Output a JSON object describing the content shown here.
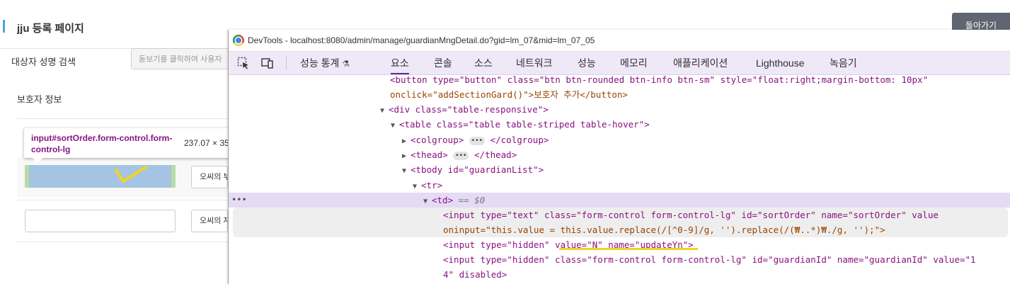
{
  "page": {
    "title": "jju 등록 페이지",
    "back_button": "돌아가기",
    "search_label": "대상자 성명 검색",
    "search_placeholder": "돋보기를 클릭하여 사용자",
    "guardian_section": "보호자 정보",
    "row1_button": "오씨의 부",
    "row2_button": "오씨의 자"
  },
  "inspector_tooltip": {
    "selector": "input#sortOrder.form-control.form-control-lg",
    "size": "237.07 × 35"
  },
  "devtools": {
    "title": "DevTools - localhost:8080/admin/manage/guardianMngDetail.do?gid=lm_07&mid=lm_07_05",
    "tabs": [
      "성능 통계",
      "요소",
      "콘솔",
      "소스",
      "네트워크",
      "성능",
      "메모리",
      "애플리케이션",
      "Lighthouse",
      "녹음기"
    ],
    "active_tab": "요소",
    "lines": {
      "l0a": "<button type=\"button\" class=\"btn btn-rounded btn-info btn-sm\" style=\"float:right;margin-bottom: 10px\"",
      "l0b": "onclick=\"addSectionGard()\">보호자 추가</button>",
      "l1": "<div class=\"table-responsive\">",
      "l2": "<table class=\"table table-striped table-hover\">",
      "l3a": "<colgroup>",
      "l3b": "</colgroup>",
      "l4a": "<thead>",
      "l4b": "</thead>",
      "l5": "<tbody id=\"guardianList\">",
      "l6": "<tr>",
      "l7a": "<td>",
      "l7b": "== $0",
      "l8a": "<input type=\"text\" class=\"form-control form-control-lg\" id=\"sortOrder\" name=\"sortOrder\" value",
      "l8b": "oninput=\"this.value = this.value.replace(/[^0-9]/g, '').replace(/(₩..*)₩./g, '');\">",
      "l9": "<input type=\"hidden\" value=\"N\" name=\"updateYn\">",
      "l10a": "<input type=\"hidden\" class=\"form-control form-control-lg\" id=\"guardianId\" name=\"guardianId\" value=\"1",
      "l10b": "4\" disabled>"
    }
  },
  "colors": {
    "selection": "#e5dbf5",
    "toolbar": "#eee8f7",
    "tag": "#881280",
    "attr": "#994500",
    "value": "#1a1aa6",
    "annotation": "#f2d422"
  }
}
